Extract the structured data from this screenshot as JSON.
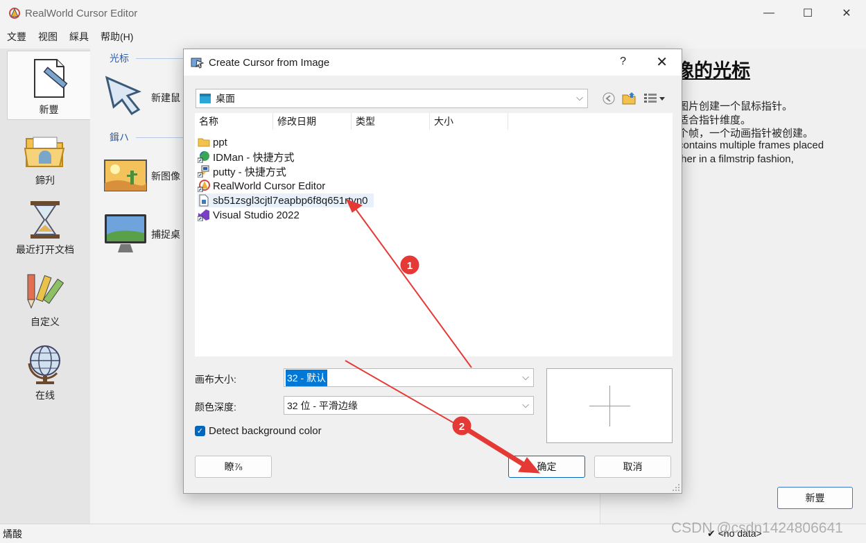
{
  "app": {
    "title": "RealWorld Cursor Editor",
    "window_controls": {
      "minimize": "—",
      "maximize": "☐",
      "close": "✕"
    }
  },
  "menu": {
    "items": [
      "文豐",
      "视图",
      "綵具",
      "帮助(H)"
    ]
  },
  "sidebar": {
    "items": [
      {
        "label": "新豐",
        "icon": "new-document-icon"
      },
      {
        "label": "鍗刋",
        "icon": "open-folder-icon"
      },
      {
        "label": "最近打开文档",
        "icon": "hourglass-icon"
      },
      {
        "label": "自定义",
        "icon": "pencils-icon"
      },
      {
        "label": "在线",
        "icon": "globe-icon"
      }
    ]
  },
  "middle": {
    "section1": "光标",
    "section2": "鍓ハ",
    "items": [
      {
        "label": "新建鼠",
        "icon": "arrow-cursor-icon"
      },
      {
        "label": "新图像",
        "icon": "desert-image-icon"
      },
      {
        "label": "捕捉桌",
        "icon": "monitor-icon"
      }
    ]
  },
  "right_panel": {
    "title": "像的光标",
    "lines": [
      "图片创建一个鼠标指针。",
      "适合指针维度。",
      "个帧，一个动画指针被创建。",
      "contains multiple frames placed",
      "ther in a filmstrip fashion,"
    ],
    "button": "新豐"
  },
  "status": {
    "left": "燏酸",
    "right": "✔ <no data>",
    "watermark": "CSDN @csdn1424806641"
  },
  "dialog": {
    "title": "Create Cursor from Image",
    "help": "?",
    "close": "✕",
    "path": "桌面",
    "columns": [
      "名称",
      "修改日期",
      "类型",
      "大小"
    ],
    "files": [
      {
        "name": "ppt",
        "icon": "folder-icon"
      },
      {
        "name": "IDMan - 快捷方式",
        "icon": "idm-shortcut-icon"
      },
      {
        "name": "putty - 快捷方式",
        "icon": "putty-shortcut-icon"
      },
      {
        "name": "RealWorld Cursor Editor",
        "icon": "realworld-shortcut-icon"
      },
      {
        "name": "sb51zsgl3cjtl7eapbp6f8q651rtyn0",
        "icon": "file-icon",
        "selected": true
      },
      {
        "name": "Visual Studio 2022",
        "icon": "visual-studio-icon"
      }
    ],
    "canvas_size_label": "画布大小:",
    "canvas_size_value": "32 - 默认",
    "color_depth_label": "颜色深度:",
    "color_depth_value": "32 位 - 平滑边缘",
    "detect_bg_label": "Detect background color",
    "detect_bg_checked": true,
    "left_button": "瞭⅞",
    "ok_button": "确定",
    "cancel_button": "取消"
  },
  "annotations": {
    "marker1": "1",
    "marker2": "2",
    "color": "#e53935"
  }
}
